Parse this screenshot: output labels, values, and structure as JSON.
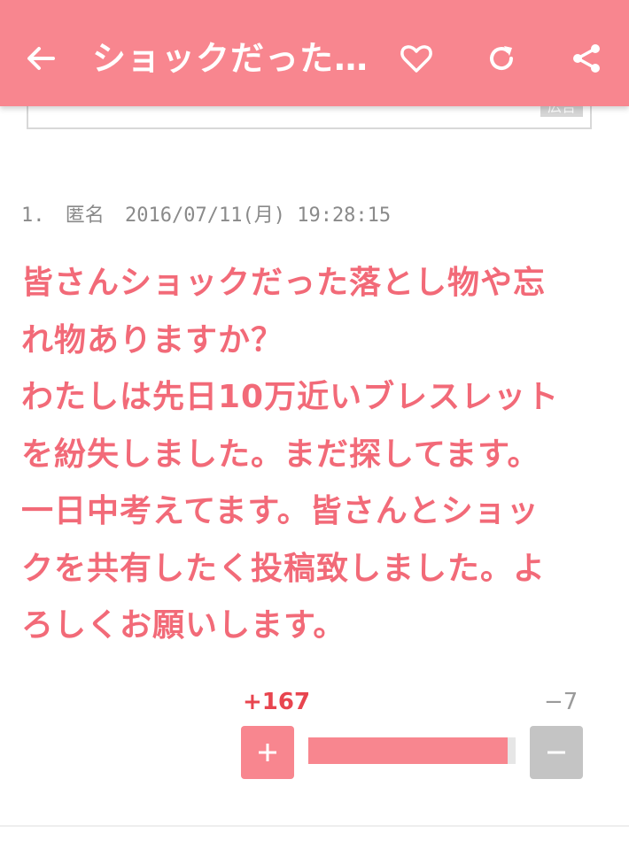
{
  "appbar": {
    "title": "ショックだった…",
    "icons": [
      "back-arrow-icon",
      "heart-icon",
      "reload-icon",
      "share-icon"
    ],
    "color": "#f8868f"
  },
  "ad": {
    "label": "広告"
  },
  "comment": {
    "number": "1.",
    "author": "匿名",
    "timestamp": "2016/07/11(月) 19:28:15",
    "body_lines": [
      "皆さんショックだった落とし物や忘",
      "れ物ありますか？",
      "わたしは先日10万近いブレスレット",
      "を紛失しました。まだ探してます。",
      "一日中考えてます。皆さんとショッ",
      "クを共有したく投稿致しました。よ",
      "ろしくお願いします。"
    ],
    "text_color": "#f26a78"
  },
  "votes": {
    "plus": "+167",
    "minus": "−7",
    "plus_ratio": 0.96,
    "plus_color": "#f8868f",
    "minus_color": "#c4c4c4"
  }
}
